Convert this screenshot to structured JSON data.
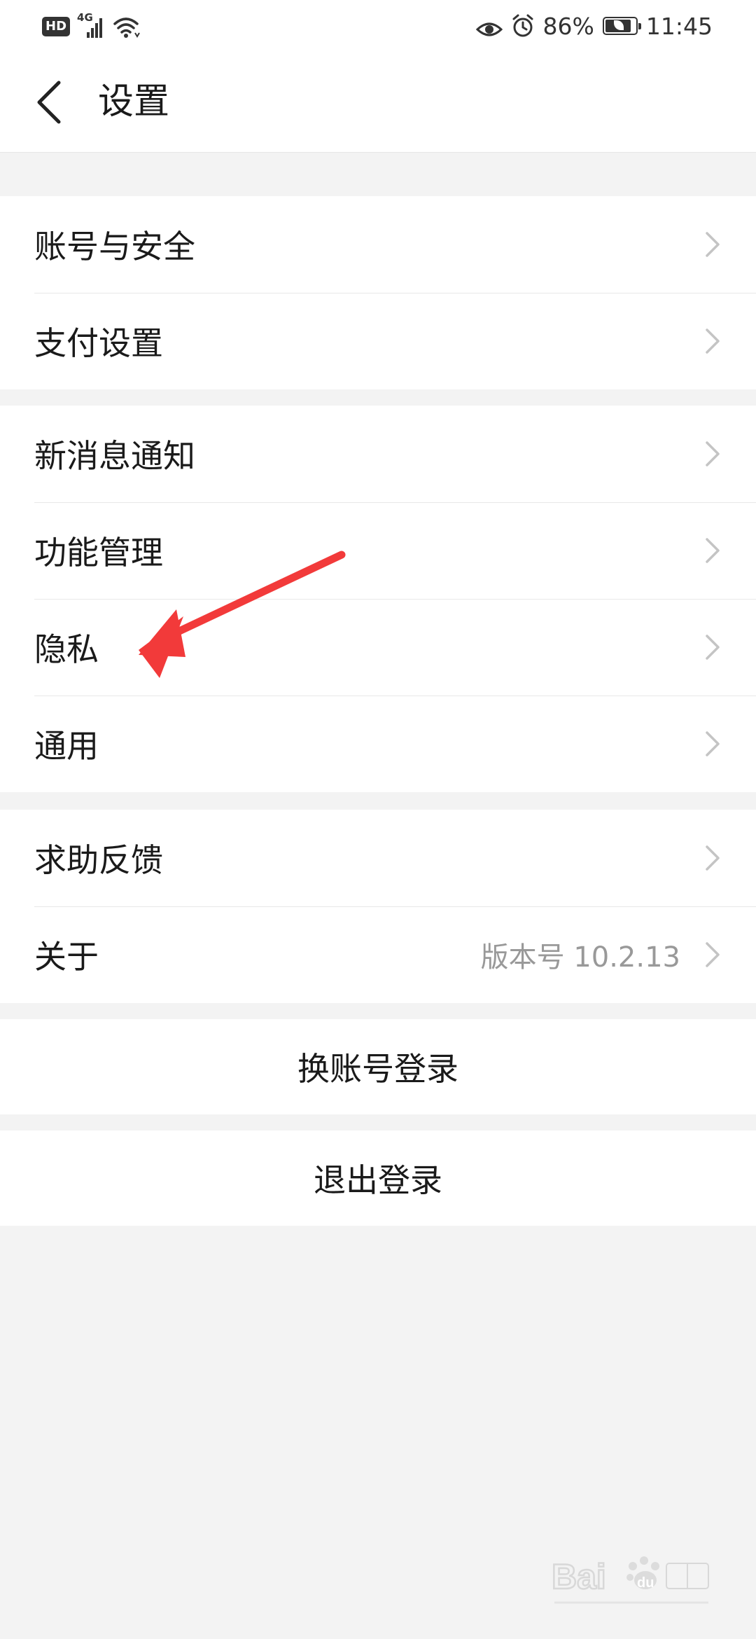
{
  "status_bar": {
    "hd_label": "HD",
    "network_label": "4G",
    "battery_percent": "86%",
    "battery_level": 0.86,
    "time": "11:45",
    "icons": [
      "signal-icon",
      "wifi-icon",
      "eye-icon",
      "alarm-icon",
      "battery-icon"
    ]
  },
  "header": {
    "title": "设置",
    "back_icon": "chevron-left-icon"
  },
  "groups": [
    {
      "items": [
        {
          "label": "账号与安全"
        },
        {
          "label": "支付设置"
        }
      ]
    },
    {
      "items": [
        {
          "label": "新消息通知"
        },
        {
          "label": "功能管理"
        },
        {
          "label": "隐私"
        },
        {
          "label": "通用"
        }
      ]
    },
    {
      "items": [
        {
          "label": "求助反馈"
        },
        {
          "label": "关于",
          "value": "版本号 10.2.13"
        }
      ]
    }
  ],
  "actions": {
    "switch_account": "换账号登录",
    "logout": "退出登录"
  },
  "colors": {
    "background": "#f3f3f3",
    "card": "#ffffff",
    "annotation_arrow": "#f23a3a",
    "secondary_text": "#999999"
  }
}
